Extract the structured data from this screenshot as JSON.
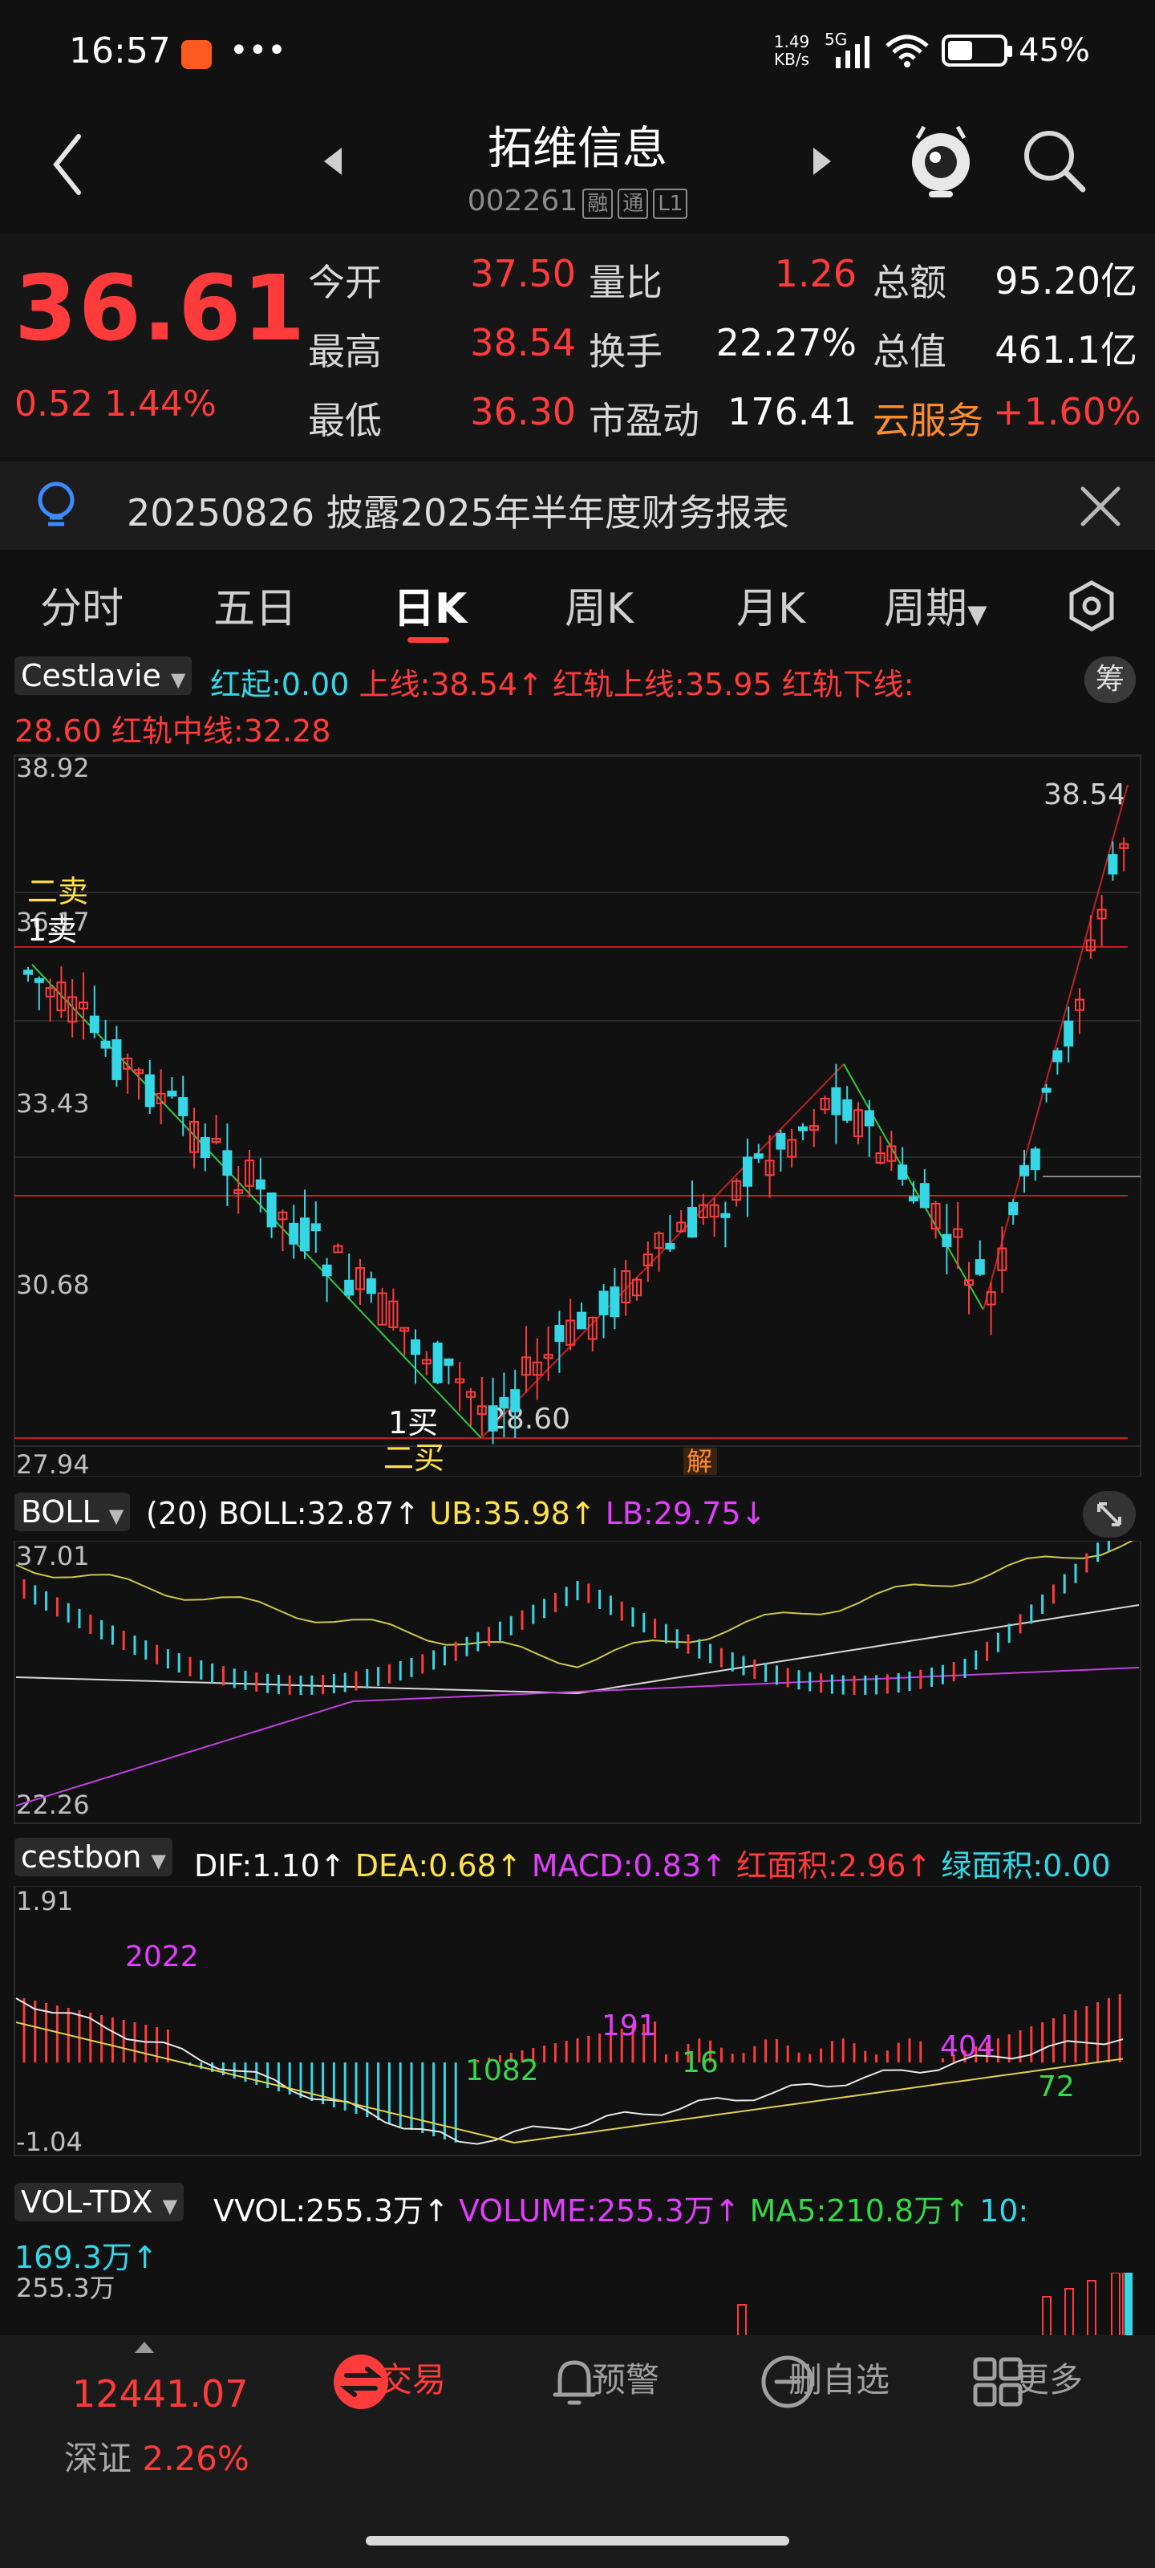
{
  "status": {
    "time": "16:57",
    "net_speed": "1.49\nKB/s",
    "network": "5G",
    "battery": "45%"
  },
  "header": {
    "title": "拓维信息",
    "code": "002261",
    "tags": [
      "融",
      "通",
      "L1"
    ]
  },
  "quote": {
    "price": "36.61",
    "change": "0.52",
    "change_pct": "1.44%",
    "fields": [
      {
        "label": "今开",
        "value": "37.50",
        "color": "#ff3b3b"
      },
      {
        "label": "最高",
        "value": "38.54",
        "color": "#ff3b3b"
      },
      {
        "label": "最低",
        "value": "36.30",
        "color": "#ff3b3b"
      },
      {
        "label": "量比",
        "value": "1.26",
        "color": "#ff3b3b"
      },
      {
        "label": "换手",
        "value": "22.27%",
        "color": "#ffffff"
      },
      {
        "label": "市盈动",
        "value": "176.41",
        "color": "#ffffff"
      },
      {
        "label": "总额",
        "value": "95.20亿",
        "color": "#ffffff"
      },
      {
        "label": "总值",
        "value": "461.1亿",
        "color": "#ffffff"
      }
    ],
    "sector": {
      "label": "云服务",
      "value": "+1.60%"
    }
  },
  "notice": {
    "text": "20250826 披露2025年半年度财务报表"
  },
  "tabs": [
    {
      "label": "分时"
    },
    {
      "label": "五日"
    },
    {
      "label": "日K"
    },
    {
      "label": "周K"
    },
    {
      "label": "月K"
    },
    {
      "label": "周期"
    }
  ],
  "indicator1": {
    "name": "Cestlavie",
    "line1": "红起:0.00",
    "line2": "上线:38.54↑",
    "line3": "红轨上线:35.95 红轨下线:",
    "line4": "28.60 红轨中线:32.28",
    "chip": "筹",
    "axis_top": "38.92",
    "axis_2": "36.17",
    "axis_3": "33.43",
    "axis_4": "30.68",
    "axis_bottom": "27.94",
    "label_high": "38.54",
    "label_low": "28.60",
    "sig_er_mai": "二卖",
    "sig_1mai": "1卖",
    "sig_1buy": "1买",
    "sig_er_buy": "二买",
    "sig_jie": "解"
  },
  "boll": {
    "name": "BOLL",
    "params": "(20)",
    "boll": "BOLL:32.87↑",
    "ub": "UB:35.98↑",
    "lb": "LB:29.75↓",
    "axis_top": "37.01",
    "axis_bottom": "22.26"
  },
  "macd": {
    "name": "cestbon",
    "dif": "DIF:1.10↑",
    "dea": "DEA:0.68↑",
    "macd": "MACD:0.83↑",
    "red_area": "红面积:2.96↑",
    "green_area": "绿面积:0.00",
    "axis_top": "1.91",
    "axis_bottom": "-1.04",
    "annotations": {
      "a1": "2022",
      "a2": "1082",
      "a3": "191",
      "a4": "16",
      "a5": "404",
      "a6": "72"
    }
  },
  "vol": {
    "name": "VOL-TDX",
    "vvol": "VVOL:255.3万↑",
    "volume": "VOLUME:255.3万↑",
    "ma5": "MA5:210.8万↑",
    "ma10a": "10:",
    "ma10b": "169.3万↑",
    "axis_top": "255.3万"
  },
  "bottom_nav": {
    "index_value": "12441.07",
    "index_name": "深证",
    "index_pct": "2.26%",
    "items": [
      {
        "label": "交易"
      },
      {
        "label": "预警"
      },
      {
        "label": "删自选"
      },
      {
        "label": "更多"
      }
    ]
  },
  "colors": {
    "up": "#ff3b3b",
    "down": "#35d7e6",
    "bg": "#111111"
  }
}
